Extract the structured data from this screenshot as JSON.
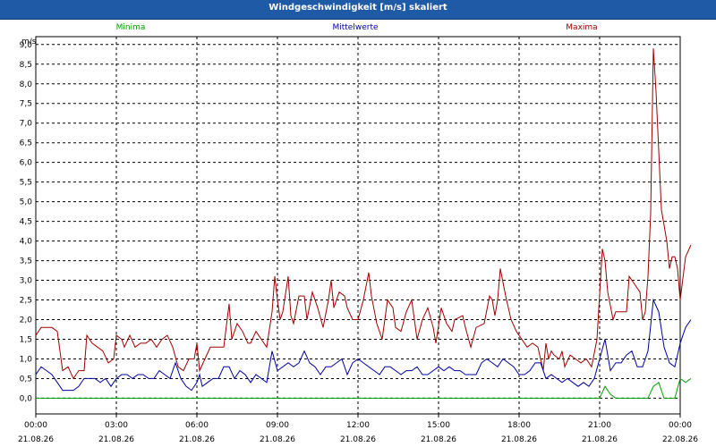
{
  "window": {
    "title": "Windgeschwindigkeit [m/s] skaliert"
  },
  "chart_data": {
    "type": "line",
    "ylabel": "m/s",
    "ylim": [
      -0.4,
      9.2
    ],
    "xlim_hours": [
      0,
      24
    ],
    "y_ticks": [
      "9,0",
      "8,5",
      "8,0",
      "7,5",
      "7,0",
      "6,5",
      "6,0",
      "5,5",
      "5,0",
      "4,5",
      "4,0",
      "3,5",
      "3,0",
      "2,5",
      "2,0",
      "1,5",
      "1,0",
      "0,5",
      "0,0"
    ],
    "y_tick_values": [
      9.0,
      8.5,
      8.0,
      7.5,
      7.0,
      6.5,
      6.0,
      5.5,
      5.0,
      4.5,
      4.0,
      3.5,
      3.0,
      2.5,
      2.0,
      1.5,
      1.0,
      0.5,
      0.0
    ],
    "x_ticks": [
      {
        "hour": 0,
        "time": "00:00",
        "date": "21.08.26"
      },
      {
        "hour": 3,
        "time": "03:00",
        "date": "21.08.26"
      },
      {
        "hour": 6,
        "time": "06:00",
        "date": "21.08.26"
      },
      {
        "hour": 9,
        "time": "09:00",
        "date": "21.08.26"
      },
      {
        "hour": 12,
        "time": "12:00",
        "date": "21.08.26"
      },
      {
        "hour": 15,
        "time": "15:00",
        "date": "21.08.26"
      },
      {
        "hour": 18,
        "time": "18:00",
        "date": "21.08.26"
      },
      {
        "hour": 21,
        "time": "21:00",
        "date": "21.08.26"
      },
      {
        "hour": 24,
        "time": "00:00",
        "date": "22.08.26"
      }
    ],
    "grid": true,
    "legend": {
      "position": "top",
      "labels": [
        "Minima",
        "Mittelwerte",
        "Maxima"
      ]
    },
    "series": [
      {
        "name": "Maxima",
        "color": "#a00000",
        "points": [
          [
            0,
            1.6
          ],
          [
            0.2,
            1.8
          ],
          [
            0.4,
            1.8
          ],
          [
            0.6,
            1.8
          ],
          [
            0.8,
            1.7
          ],
          [
            1.0,
            0.7
          ],
          [
            1.2,
            0.8
          ],
          [
            1.4,
            0.5
          ],
          [
            1.6,
            0.7
          ],
          [
            1.8,
            0.7
          ],
          [
            1.9,
            1.6
          ],
          [
            2.1,
            1.4
          ],
          [
            2.3,
            1.3
          ],
          [
            2.5,
            1.2
          ],
          [
            2.7,
            0.9
          ],
          [
            2.9,
            1.0
          ],
          [
            3.0,
            1.6
          ],
          [
            3.2,
            1.5
          ],
          [
            3.3,
            1.3
          ],
          [
            3.5,
            1.6
          ],
          [
            3.7,
            1.3
          ],
          [
            3.9,
            1.4
          ],
          [
            4.1,
            1.4
          ],
          [
            4.3,
            1.5
          ],
          [
            4.5,
            1.3
          ],
          [
            4.7,
            1.5
          ],
          [
            4.9,
            1.6
          ],
          [
            5.1,
            1.3
          ],
          [
            5.3,
            0.8
          ],
          [
            5.5,
            0.7
          ],
          [
            5.7,
            1.0
          ],
          [
            5.9,
            1.0
          ],
          [
            6.0,
            1.4
          ],
          [
            6.1,
            0.7
          ],
          [
            6.3,
            1.0
          ],
          [
            6.5,
            1.3
          ],
          [
            6.8,
            1.3
          ],
          [
            7.0,
            1.3
          ],
          [
            7.2,
            2.4
          ],
          [
            7.3,
            1.5
          ],
          [
            7.5,
            1.9
          ],
          [
            7.7,
            1.7
          ],
          [
            7.9,
            1.4
          ],
          [
            8.0,
            1.4
          ],
          [
            8.2,
            1.7
          ],
          [
            8.4,
            1.5
          ],
          [
            8.6,
            1.3
          ],
          [
            8.8,
            2.2
          ],
          [
            8.9,
            3.1
          ],
          [
            9.0,
            2.5
          ],
          [
            9.1,
            2.0
          ],
          [
            9.2,
            2.2
          ],
          [
            9.4,
            3.1
          ],
          [
            9.5,
            2.1
          ],
          [
            9.6,
            1.9
          ],
          [
            9.8,
            2.6
          ],
          [
            10.0,
            2.6
          ],
          [
            10.1,
            2.0
          ],
          [
            10.3,
            2.7
          ],
          [
            10.5,
            2.3
          ],
          [
            10.7,
            1.8
          ],
          [
            10.9,
            2.5
          ],
          [
            11.0,
            3.0
          ],
          [
            11.1,
            2.3
          ],
          [
            11.3,
            2.7
          ],
          [
            11.5,
            2.6
          ],
          [
            11.6,
            2.3
          ],
          [
            11.8,
            2.0
          ],
          [
            12.0,
            2.0
          ],
          [
            12.2,
            2.5
          ],
          [
            12.4,
            3.2
          ],
          [
            12.5,
            2.6
          ],
          [
            12.7,
            1.9
          ],
          [
            12.9,
            1.5
          ],
          [
            13.1,
            2.5
          ],
          [
            13.3,
            2.3
          ],
          [
            13.4,
            1.8
          ],
          [
            13.6,
            1.7
          ],
          [
            13.8,
            2.2
          ],
          [
            14.0,
            2.5
          ],
          [
            14.2,
            1.5
          ],
          [
            14.4,
            2.0
          ],
          [
            14.6,
            2.3
          ],
          [
            14.8,
            1.8
          ],
          [
            14.9,
            1.4
          ],
          [
            15.1,
            2.3
          ],
          [
            15.3,
            1.9
          ],
          [
            15.5,
            1.7
          ],
          [
            15.6,
            2.0
          ],
          [
            15.9,
            2.1
          ],
          [
            16.0,
            1.8
          ],
          [
            16.2,
            1.3
          ],
          [
            16.4,
            1.8
          ],
          [
            16.7,
            1.9
          ],
          [
            16.9,
            2.6
          ],
          [
            17.0,
            2.5
          ],
          [
            17.1,
            2.1
          ],
          [
            17.2,
            2.5
          ],
          [
            17.3,
            3.3
          ],
          [
            17.5,
            2.6
          ],
          [
            17.7,
            2.0
          ],
          [
            17.9,
            1.7
          ],
          [
            18.1,
            1.5
          ],
          [
            18.3,
            1.3
          ],
          [
            18.5,
            1.4
          ],
          [
            18.7,
            1.3
          ],
          [
            18.9,
            0.7
          ],
          [
            19.0,
            1.4
          ],
          [
            19.1,
            1.0
          ],
          [
            19.2,
            1.2
          ],
          [
            19.3,
            1.1
          ],
          [
            19.5,
            1.0
          ],
          [
            19.6,
            1.2
          ],
          [
            19.7,
            0.8
          ],
          [
            19.9,
            1.1
          ],
          [
            20.1,
            1.0
          ],
          [
            20.3,
            0.9
          ],
          [
            20.5,
            1.0
          ],
          [
            20.7,
            0.8
          ],
          [
            20.9,
            1.5
          ],
          [
            21.1,
            3.8
          ],
          [
            21.2,
            3.5
          ],
          [
            21.3,
            2.7
          ],
          [
            21.5,
            2.0
          ],
          [
            21.6,
            2.2
          ],
          [
            21.8,
            2.2
          ],
          [
            22.0,
            2.2
          ],
          [
            22.1,
            3.1
          ],
          [
            22.3,
            2.9
          ],
          [
            22.5,
            2.7
          ],
          [
            22.6,
            2.0
          ],
          [
            22.7,
            2.2
          ],
          [
            22.8,
            3.1
          ],
          [
            22.9,
            4.7
          ],
          [
            23.0,
            8.9
          ],
          [
            23.1,
            7.8
          ],
          [
            23.3,
            4.8
          ],
          [
            23.5,
            4.0
          ],
          [
            23.6,
            3.3
          ],
          [
            23.7,
            3.6
          ],
          [
            23.8,
            3.6
          ],
          [
            23.9,
            3.3
          ],
          [
            24.0,
            2.5
          ],
          [
            24.2,
            3.6
          ],
          [
            24.4,
            3.9
          ]
        ]
      },
      {
        "name": "Mittelwerte",
        "color": "#0000a0",
        "points": [
          [
            0,
            0.6
          ],
          [
            0.2,
            0.8
          ],
          [
            0.4,
            0.7
          ],
          [
            0.6,
            0.6
          ],
          [
            0.8,
            0.4
          ],
          [
            1.0,
            0.2
          ],
          [
            1.2,
            0.2
          ],
          [
            1.4,
            0.2
          ],
          [
            1.6,
            0.3
          ],
          [
            1.8,
            0.5
          ],
          [
            2.0,
            0.5
          ],
          [
            2.2,
            0.5
          ],
          [
            2.4,
            0.4
          ],
          [
            2.6,
            0.5
          ],
          [
            2.8,
            0.3
          ],
          [
            3.0,
            0.5
          ],
          [
            3.2,
            0.6
          ],
          [
            3.4,
            0.6
          ],
          [
            3.6,
            0.5
          ],
          [
            3.8,
            0.6
          ],
          [
            4.0,
            0.6
          ],
          [
            4.2,
            0.5
          ],
          [
            4.4,
            0.5
          ],
          [
            4.6,
            0.7
          ],
          [
            4.8,
            0.6
          ],
          [
            5.0,
            0.5
          ],
          [
            5.2,
            0.9
          ],
          [
            5.4,
            0.5
          ],
          [
            5.6,
            0.3
          ],
          [
            5.8,
            0.2
          ],
          [
            6.0,
            0.4
          ],
          [
            6.1,
            0.6
          ],
          [
            6.2,
            0.3
          ],
          [
            6.4,
            0.4
          ],
          [
            6.6,
            0.5
          ],
          [
            6.8,
            0.5
          ],
          [
            7.0,
            0.8
          ],
          [
            7.2,
            0.8
          ],
          [
            7.4,
            0.5
          ],
          [
            7.6,
            0.7
          ],
          [
            7.8,
            0.6
          ],
          [
            8.0,
            0.4
          ],
          [
            8.2,
            0.6
          ],
          [
            8.4,
            0.5
          ],
          [
            8.6,
            0.4
          ],
          [
            8.8,
            1.2
          ],
          [
            9.0,
            0.7
          ],
          [
            9.2,
            0.8
          ],
          [
            9.4,
            0.9
          ],
          [
            9.6,
            0.8
          ],
          [
            9.8,
            0.9
          ],
          [
            10.0,
            1.2
          ],
          [
            10.2,
            0.9
          ],
          [
            10.4,
            0.8
          ],
          [
            10.6,
            0.6
          ],
          [
            10.8,
            0.8
          ],
          [
            11.0,
            0.8
          ],
          [
            11.2,
            0.9
          ],
          [
            11.4,
            1.0
          ],
          [
            11.6,
            0.6
          ],
          [
            11.8,
            0.9
          ],
          [
            12.0,
            1.0
          ],
          [
            12.2,
            0.9
          ],
          [
            12.4,
            0.8
          ],
          [
            12.6,
            0.7
          ],
          [
            12.8,
            0.6
          ],
          [
            13.0,
            0.8
          ],
          [
            13.2,
            0.8
          ],
          [
            13.4,
            0.7
          ],
          [
            13.6,
            0.6
          ],
          [
            13.8,
            0.7
          ],
          [
            14.0,
            0.7
          ],
          [
            14.2,
            0.8
          ],
          [
            14.4,
            0.6
          ],
          [
            14.6,
            0.6
          ],
          [
            14.8,
            0.7
          ],
          [
            15.0,
            0.8
          ],
          [
            15.2,
            0.7
          ],
          [
            15.4,
            0.8
          ],
          [
            15.6,
            0.7
          ],
          [
            15.8,
            0.7
          ],
          [
            16.0,
            0.6
          ],
          [
            16.2,
            0.6
          ],
          [
            16.4,
            0.6
          ],
          [
            16.6,
            0.9
          ],
          [
            16.8,
            1.0
          ],
          [
            17.0,
            0.9
          ],
          [
            17.2,
            0.8
          ],
          [
            17.4,
            1.0
          ],
          [
            17.6,
            0.9
          ],
          [
            17.8,
            0.8
          ],
          [
            18.0,
            0.6
          ],
          [
            18.2,
            0.6
          ],
          [
            18.4,
            0.7
          ],
          [
            18.6,
            0.9
          ],
          [
            18.8,
            0.9
          ],
          [
            19.0,
            0.5
          ],
          [
            19.2,
            0.6
          ],
          [
            19.4,
            0.5
          ],
          [
            19.6,
            0.4
          ],
          [
            19.8,
            0.5
          ],
          [
            20.0,
            0.4
          ],
          [
            20.2,
            0.3
          ],
          [
            20.4,
            0.4
          ],
          [
            20.6,
            0.3
          ],
          [
            20.8,
            0.5
          ],
          [
            21.0,
            1.0
          ],
          [
            21.2,
            1.5
          ],
          [
            21.4,
            0.7
          ],
          [
            21.6,
            0.9
          ],
          [
            21.8,
            0.9
          ],
          [
            22.0,
            1.1
          ],
          [
            22.2,
            1.2
          ],
          [
            22.4,
            0.8
          ],
          [
            22.6,
            0.8
          ],
          [
            22.8,
            1.2
          ],
          [
            23.0,
            2.5
          ],
          [
            23.2,
            2.2
          ],
          [
            23.4,
            1.3
          ],
          [
            23.6,
            0.9
          ],
          [
            23.8,
            0.8
          ],
          [
            24.0,
            1.4
          ],
          [
            24.2,
            1.8
          ],
          [
            24.4,
            2.0
          ]
        ]
      },
      {
        "name": "Minima",
        "color": "#00a000",
        "points": [
          [
            0,
            0
          ],
          [
            21.0,
            0
          ],
          [
            21.2,
            0.3
          ],
          [
            21.4,
            0.1
          ],
          [
            21.6,
            0
          ],
          [
            22.8,
            0
          ],
          [
            23.0,
            0.3
          ],
          [
            23.2,
            0.4
          ],
          [
            23.4,
            0
          ],
          [
            23.8,
            0
          ],
          [
            24.0,
            0.5
          ],
          [
            24.2,
            0.4
          ],
          [
            24.4,
            0.5
          ]
        ]
      }
    ]
  }
}
